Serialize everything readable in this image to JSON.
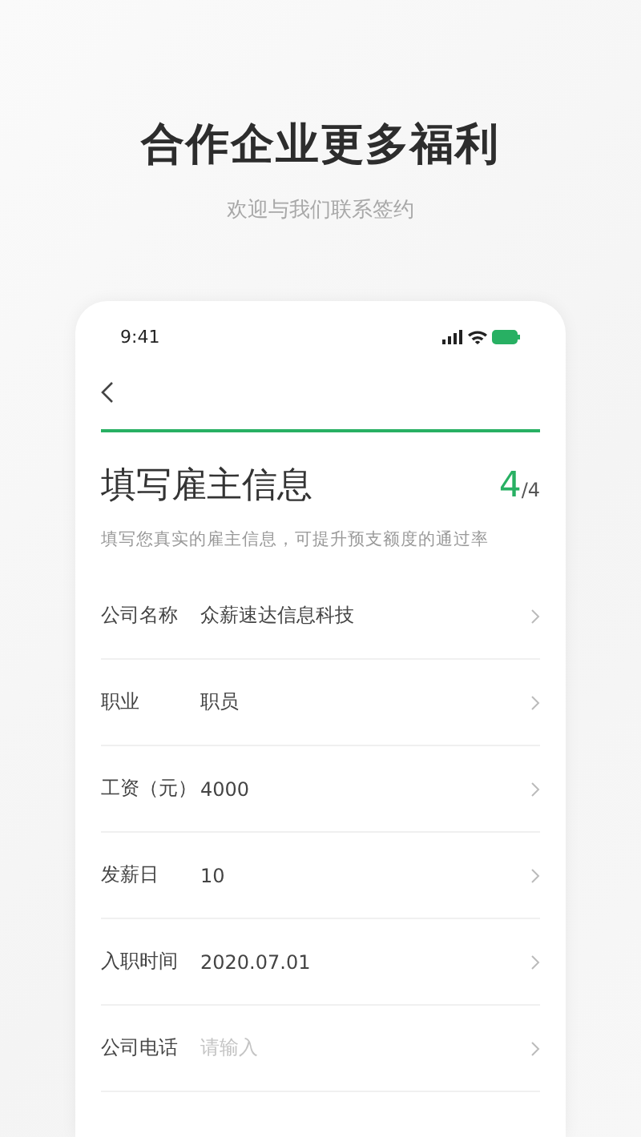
{
  "header": {
    "title": "合作企业更多福利",
    "subtitle": "欢迎与我们联系签约"
  },
  "phone": {
    "status_bar": {
      "time": "9:41"
    },
    "form": {
      "title": "填写雇主信息",
      "step": "4",
      "total": "/4",
      "hint": "填写您真实的雇主信息，可提升预支额度的通过率",
      "fields": [
        {
          "label": "公司名称",
          "value": "众薪速达信息科技"
        },
        {
          "label": "职业",
          "value": "职员"
        },
        {
          "label": "工资（元）",
          "value": "4000"
        },
        {
          "label": "发薪日",
          "value": "10"
        },
        {
          "label": "入职时间",
          "value": "2020.07.01"
        },
        {
          "label": "公司电话",
          "placeholder": "请输入"
        }
      ]
    }
  }
}
